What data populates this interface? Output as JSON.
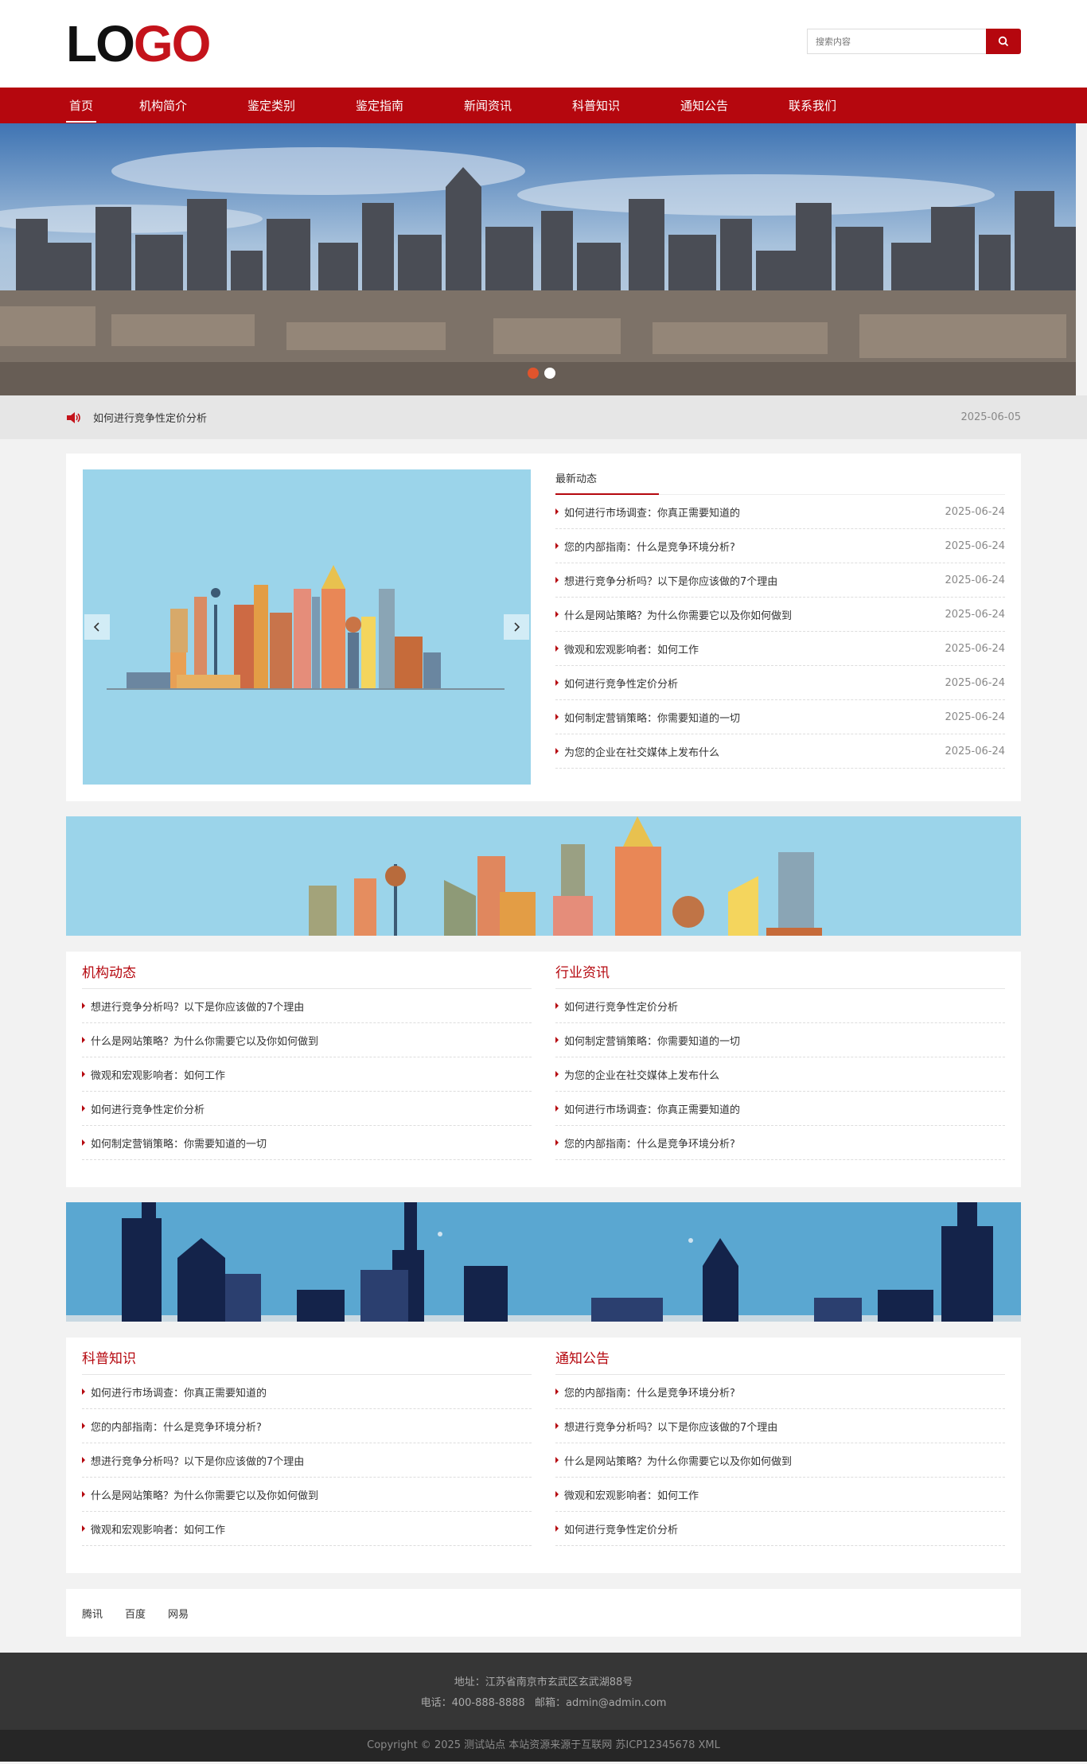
{
  "header": {
    "logo": {
      "part1": "L",
      "part2": "O",
      "part3": "GO"
    },
    "search": {
      "placeholder": "搜索内容",
      "icon": "search-icon"
    }
  },
  "nav": {
    "items": [
      "首页",
      "机构简介",
      "鉴定类别",
      "鉴定指南",
      "新闻资讯",
      "科普知识",
      "通知公告",
      "联系我们"
    ],
    "active": 0
  },
  "banner": {
    "slide_count": 2,
    "active_slide": 0
  },
  "notice": {
    "icon": "speaker-icon",
    "text": "如何进行竞争性定价分析",
    "date": "2025-06-05"
  },
  "latest": {
    "title": "最新动态",
    "items": [
      {
        "title": "如何进行市场调查：你真正需要知道的",
        "date": "2025-06-24"
      },
      {
        "title": "您的内部指南：什么是竞争环境分析?",
        "date": "2025-06-24"
      },
      {
        "title": "想进行竞争分析吗？以下是你应该做的7个理由",
        "date": "2025-06-24"
      },
      {
        "title": "什么是网站策略？为什么你需要它以及你如何做到",
        "date": "2025-06-24"
      },
      {
        "title": "微观和宏观影响者：如何工作",
        "date": "2025-06-24"
      },
      {
        "title": "如何进行竞争性定价分析",
        "date": "2025-06-24"
      },
      {
        "title": "如何制定营销策略：你需要知道的一切",
        "date": "2025-06-24"
      },
      {
        "title": "为您的企业在社交媒体上发布什么",
        "date": "2025-06-24"
      }
    ]
  },
  "section_a": {
    "left": {
      "title": "机构动态",
      "items": [
        "想进行竞争分析吗？以下是你应该做的7个理由",
        "什么是网站策略？为什么你需要它以及你如何做到",
        "微观和宏观影响者：如何工作",
        "如何进行竞争性定价分析",
        "如何制定营销策略：你需要知道的一切"
      ]
    },
    "right": {
      "title": "行业资讯",
      "items": [
        "如何进行竞争性定价分析",
        "如何制定营销策略：你需要知道的一切",
        "为您的企业在社交媒体上发布什么",
        "如何进行市场调查：你真正需要知道的",
        "您的内部指南：什么是竞争环境分析?"
      ]
    }
  },
  "section_b": {
    "left": {
      "title": "科普知识",
      "items": [
        "如何进行市场调查：你真正需要知道的",
        "您的内部指南：什么是竞争环境分析?",
        "想进行竞争分析吗？以下是你应该做的7个理由",
        "什么是网站策略？为什么你需要它以及你如何做到",
        "微观和宏观影响者：如何工作"
      ]
    },
    "right": {
      "title": "通知公告",
      "items": [
        "您的内部指南：什么是竞争环境分析?",
        "想进行竞争分析吗？以下是你应该做的7个理由",
        "什么是网站策略？为什么你需要它以及你如何做到",
        "微观和宏观影响者：如何工作",
        "如何进行竞争性定价分析"
      ]
    }
  },
  "friends": [
    "腾讯",
    "百度",
    "网易"
  ],
  "footer": {
    "address": "地址：江苏省南京市玄武区玄武湖88号",
    "contact": "电话：400-888-8888   邮箱：admin@admin.com",
    "copyright": "Copyright © 2025 测试站点 本站资源来源于互联网 苏ICP12345678 XML"
  },
  "colors": {
    "brand": "#b5070e",
    "footer": "#363636"
  }
}
